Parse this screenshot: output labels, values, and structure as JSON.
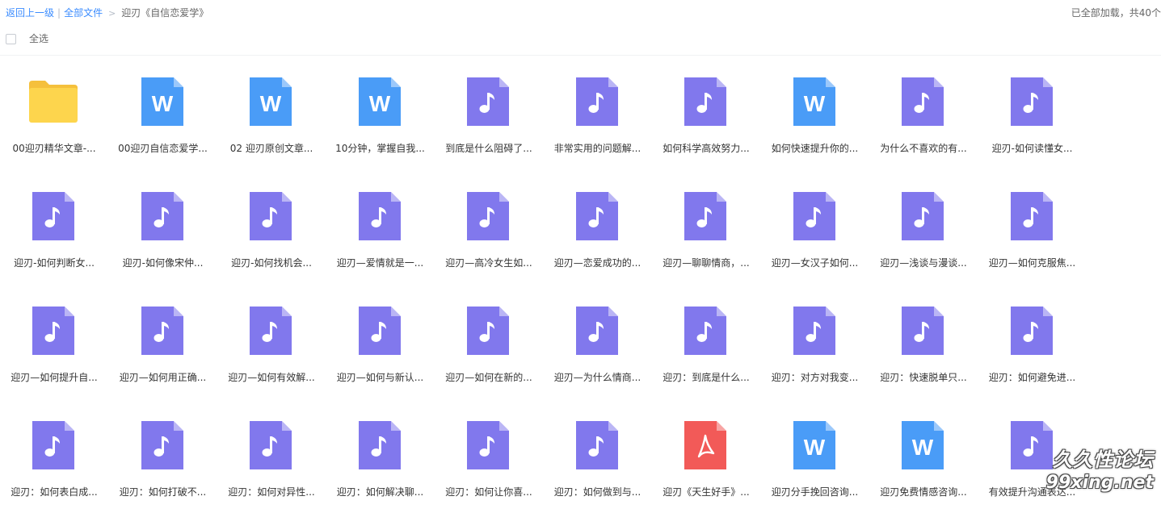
{
  "breadcrumb": {
    "back_label": "返回上一级",
    "separator": "|",
    "all_files_label": "全部文件",
    "arrow": ">",
    "current_folder": "迎刃《自信恋爱学》"
  },
  "load_status": "已全部加载，共40个",
  "select_all_label": "全选",
  "colors": {
    "link": "#3b8cff",
    "folder": "#fdd54d",
    "folder_back": "#f5c03c",
    "word": "#4a9cf7",
    "audio": "#8178ed",
    "pdf": "#f25a58"
  },
  "files": [
    {
      "name": "00迎刃精华文章-...",
      "type": "folder"
    },
    {
      "name": "00迎刃自信恋爱学...",
      "type": "word"
    },
    {
      "name": "02 迎刃原创文章...",
      "type": "word"
    },
    {
      "name": "10分钟，掌握自我...",
      "type": "word"
    },
    {
      "name": "到底是什么阻碍了...",
      "type": "audio"
    },
    {
      "name": "非常实用的问题解...",
      "type": "audio"
    },
    {
      "name": "如何科学高效努力...",
      "type": "audio"
    },
    {
      "name": "如何快速提升你的...",
      "type": "word"
    },
    {
      "name": "为什么不喜欢的有...",
      "type": "audio"
    },
    {
      "name": "迎刃-如何读懂女...",
      "type": "audio"
    },
    {
      "name": "迎刃-如何判断女...",
      "type": "audio"
    },
    {
      "name": "迎刃-如何像宋仲...",
      "type": "audio"
    },
    {
      "name": "迎刃-如何找机会...",
      "type": "audio"
    },
    {
      "name": "迎刃—爱情就是一...",
      "type": "audio"
    },
    {
      "name": "迎刃—高冷女生如...",
      "type": "audio"
    },
    {
      "name": "迎刃—恋爱成功的...",
      "type": "audio"
    },
    {
      "name": "迎刃—聊聊情商，...",
      "type": "audio"
    },
    {
      "name": "迎刃—女汉子如何...",
      "type": "audio"
    },
    {
      "name": "迎刃—浅谈与漫谈...",
      "type": "audio"
    },
    {
      "name": "迎刃—如何克服焦...",
      "type": "audio"
    },
    {
      "name": "迎刃—如何提升自...",
      "type": "audio"
    },
    {
      "name": "迎刃—如何用正确...",
      "type": "audio"
    },
    {
      "name": "迎刃—如何有效解...",
      "type": "audio"
    },
    {
      "name": "迎刃—如何与新认...",
      "type": "audio"
    },
    {
      "name": "迎刃—如何在新的...",
      "type": "audio"
    },
    {
      "name": "迎刃—为什么情商...",
      "type": "audio"
    },
    {
      "name": "迎刃：到底是什么...",
      "type": "audio"
    },
    {
      "name": "迎刃：对方对我变...",
      "type": "audio"
    },
    {
      "name": "迎刃：快速脱单只...",
      "type": "audio"
    },
    {
      "name": "迎刃：如何避免进...",
      "type": "audio"
    },
    {
      "name": "迎刃：如何表白成...",
      "type": "audio"
    },
    {
      "name": "迎刃：如何打破不...",
      "type": "audio"
    },
    {
      "name": "迎刃：如何对异性...",
      "type": "audio"
    },
    {
      "name": "迎刃：如何解决聊...",
      "type": "audio"
    },
    {
      "name": "迎刃：如何让你喜...",
      "type": "audio"
    },
    {
      "name": "迎刃：如何做到与...",
      "type": "audio"
    },
    {
      "name": "迎刃《天生好手》...",
      "type": "pdf"
    },
    {
      "name": "迎刃分手挽回咨询...",
      "type": "word"
    },
    {
      "name": "迎刃免费情感咨询...",
      "type": "word"
    },
    {
      "name": "有效提升沟通表达...",
      "type": "audio"
    }
  ],
  "watermark": {
    "line1": "久久性论坛",
    "line2": "99xing.net"
  }
}
